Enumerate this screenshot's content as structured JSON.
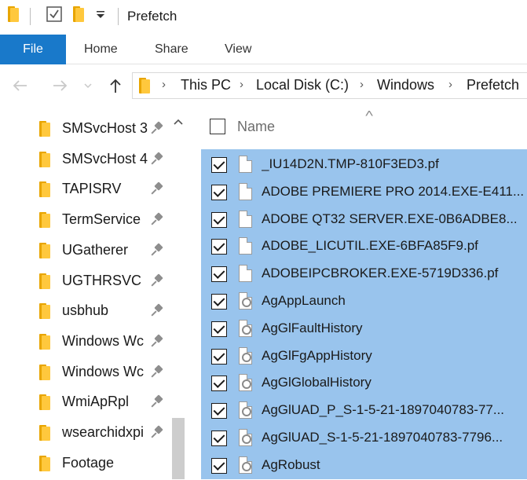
{
  "window": {
    "title": "Prefetch"
  },
  "ribbon": {
    "tabs": [
      "File",
      "Home",
      "Share",
      "View"
    ]
  },
  "address": {
    "crumbs": [
      "This PC",
      "Local Disk (C:)",
      "Windows",
      "Prefetch"
    ]
  },
  "nav_pane": {
    "items": [
      "SMSvcHost 3",
      "SMSvcHost 4",
      "TAPISRV",
      "TermService",
      "UGatherer",
      "UGTHRSVC",
      "usbhub",
      "Windows Wc",
      "Windows Wc",
      "WmiApRpl",
      "wsearchidxpi",
      "Footage"
    ],
    "pinned": [
      true,
      true,
      true,
      true,
      true,
      true,
      true,
      true,
      true,
      true,
      true,
      false
    ]
  },
  "file_list": {
    "column_name": "Name",
    "files": [
      {
        "name": "_IU14D2N.TMP-810F3ED3.pf",
        "icon": "document-icon",
        "checked": true
      },
      {
        "name": "ADOBE PREMIERE PRO 2014.EXE-E411...",
        "icon": "document-icon",
        "checked": true
      },
      {
        "name": "ADOBE QT32 SERVER.EXE-0B6ADBE8...",
        "icon": "document-icon",
        "checked": true
      },
      {
        "name": "ADOBE_LICUTIL.EXE-6BFA85F9.pf",
        "icon": "document-icon",
        "checked": true
      },
      {
        "name": "ADOBEIPCBROKER.EXE-5719D336.pf",
        "icon": "document-icon",
        "checked": true
      },
      {
        "name": "AgAppLaunch",
        "icon": "system-file-icon",
        "checked": true
      },
      {
        "name": "AgGlFaultHistory",
        "icon": "system-file-icon",
        "checked": true
      },
      {
        "name": "AgGlFgAppHistory",
        "icon": "system-file-icon",
        "checked": true
      },
      {
        "name": "AgGlGlobalHistory",
        "icon": "system-file-icon",
        "checked": true
      },
      {
        "name": "AgGlUAD_P_S-1-5-21-1897040783-77...",
        "icon": "system-file-icon",
        "checked": true
      },
      {
        "name": "AgGlUAD_S-1-5-21-1897040783-7796...",
        "icon": "system-file-icon",
        "checked": true
      },
      {
        "name": "AgRobust",
        "icon": "system-file-icon",
        "checked": true
      }
    ]
  },
  "colors": {
    "accent": "#1979ca",
    "selection": "#99c4ed",
    "folder": "#ffc83d"
  }
}
